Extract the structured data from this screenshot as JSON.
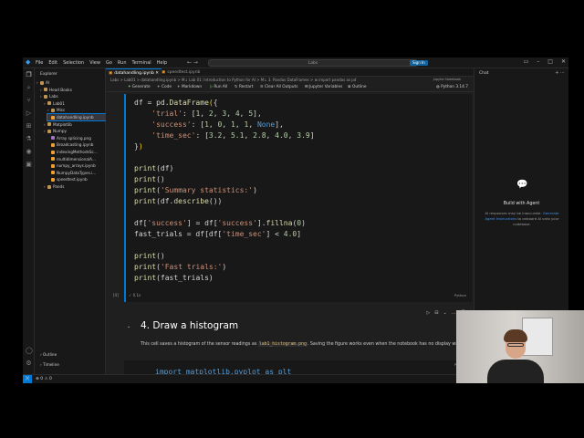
{
  "titlebar": {
    "menus": [
      "File",
      "Edit",
      "Selection",
      "View",
      "Go",
      "Run",
      "Terminal",
      "Help"
    ],
    "search_placeholder": "Labs",
    "signin_label": "Sign In"
  },
  "explorer": {
    "title": "Explorer",
    "items": [
      {
        "label": "AI",
        "depth": 0,
        "type": "folder"
      },
      {
        "label": "Head Books",
        "depth": 1,
        "type": "folder"
      },
      {
        "label": "Labs",
        "depth": 1,
        "type": "folder"
      },
      {
        "label": "Lab01",
        "depth": 2,
        "type": "folder"
      },
      {
        "label": "Misc",
        "depth": 3,
        "type": "folder"
      },
      {
        "label": "datahandling.ipynb",
        "depth": 3,
        "type": "notebook",
        "selected": true
      },
      {
        "label": "Matplotlib",
        "depth": 2,
        "type": "folder"
      },
      {
        "label": "Numpy",
        "depth": 2,
        "type": "folder"
      },
      {
        "label": "Array splicing.png",
        "depth": 3,
        "type": "image"
      },
      {
        "label": "Broadcasting.ipynb",
        "depth": 3,
        "type": "notebook"
      },
      {
        "label": "indexingMethodsSc...",
        "depth": 3,
        "type": "notebook"
      },
      {
        "label": "multidimensionalA...",
        "depth": 3,
        "type": "notebook"
      },
      {
        "label": "numpy_arrays.ipynb",
        "depth": 3,
        "type": "notebook"
      },
      {
        "label": "NumpyDataTypes.i...",
        "depth": 3,
        "type": "notebook"
      },
      {
        "label": "speedtest.ipynb",
        "depth": 3,
        "type": "notebook"
      },
      {
        "label": "Pands",
        "depth": 2,
        "type": "folder"
      }
    ],
    "outline_label": "Outline",
    "timeline_label": "Timeline"
  },
  "editor": {
    "tabs": [
      {
        "label": "datahandling.ipynb",
        "active": true
      },
      {
        "label": "speedtest.ipynb",
        "active": false
      }
    ],
    "breadcrumb": "Labs > Lab01 > datahandling.ipynb > M↓ Lab 01: Introduction to Python for AI > M↓ 3. Pandas DataFrames > ⊞ import pandas as pd",
    "kernel_hint": "Jupyter Notebook",
    "toolbar": {
      "generate": "Generate",
      "code": "Code",
      "markdown": "Markdown",
      "run_all": "Run All",
      "restart": "Restart",
      "clear_all_outputs": "Clear All Outputs",
      "jupyter_variables": "Jupyter Variables",
      "outline": "Outline",
      "kernel": "Python 3.14.7"
    },
    "code_cell": {
      "exec_label": "[4]",
      "time": "0.1s",
      "language": "Python"
    },
    "markdown_cell": {
      "heading": "4. Draw a histogram",
      "text_before": "This cell saves a histogram of the sensor readings as ",
      "code_inline": "lab1_histogram.png",
      "text_after": ". Saving the figure works even when the notebook has no display window."
    },
    "code_cell2": {
      "code": "import matplotlib.pyplot as plt",
      "language": "Python"
    }
  },
  "chat": {
    "title": "Chat",
    "heading": "Build with Agent",
    "text_1": "AI responses may be inaccurate.",
    "link": "Generate Agent Instructions",
    "text_2": "to onboard AI onto your codebase."
  },
  "statusbar": {
    "errors": "⊗ 0 ⚠ 0"
  }
}
